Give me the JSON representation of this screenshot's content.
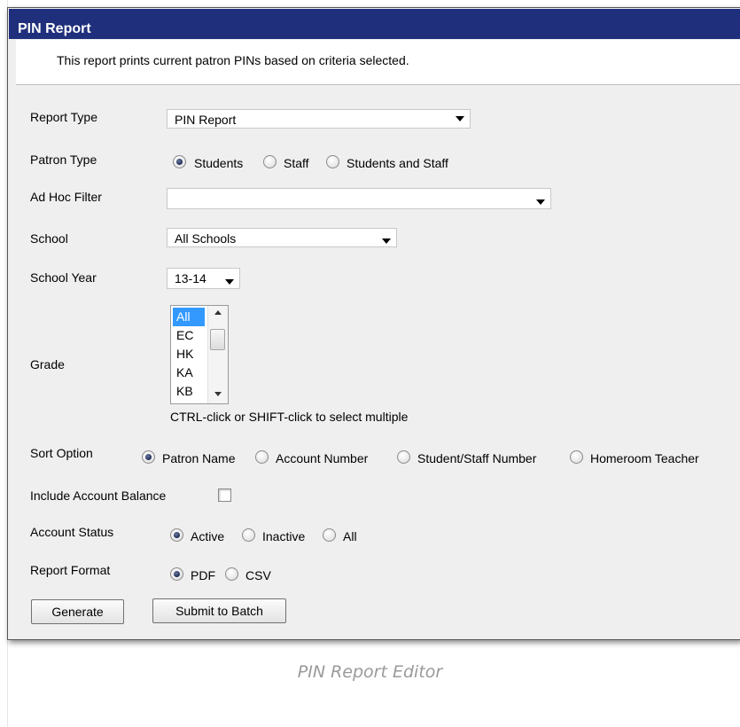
{
  "window": {
    "title": "PIN Report",
    "description": "This report prints current patron PINs based on criteria selected."
  },
  "form": {
    "report_type": {
      "label": "Report Type",
      "value": "PIN Report"
    },
    "patron_type": {
      "label": "Patron Type",
      "options": [
        "Students",
        "Staff",
        "Students and Staff"
      ],
      "selected": "Students"
    },
    "ad_hoc_filter": {
      "label": "Ad Hoc Filter",
      "value": ""
    },
    "school": {
      "label": "School",
      "value": "All Schools"
    },
    "school_year": {
      "label": "School Year",
      "value": "13-14"
    },
    "grade": {
      "label": "Grade",
      "items": [
        "All",
        "EC",
        "HK",
        "KA",
        "KB"
      ],
      "selected": "All",
      "hint": "CTRL-click or SHIFT-click to select multiple"
    },
    "sort_option": {
      "label": "Sort Option",
      "options": [
        "Patron Name",
        "Account Number",
        "Student/Staff Number",
        "Homeroom Teacher"
      ],
      "selected": "Patron Name"
    },
    "include_account_balance": {
      "label": "Include Account Balance",
      "checked": false
    },
    "account_status": {
      "label": "Account Status",
      "options": [
        "Active",
        "Inactive",
        "All"
      ],
      "selected": "Active"
    },
    "report_format": {
      "label": "Report Format",
      "options": [
        "PDF",
        "CSV"
      ],
      "selected": "PDF"
    }
  },
  "buttons": {
    "generate": "Generate",
    "submit_to_batch": "Submit to Batch"
  },
  "caption": "PIN Report Editor",
  "colors": {
    "titlebar": "#1f2f7c",
    "panel": "#efefef",
    "selection": "#3399ff"
  }
}
